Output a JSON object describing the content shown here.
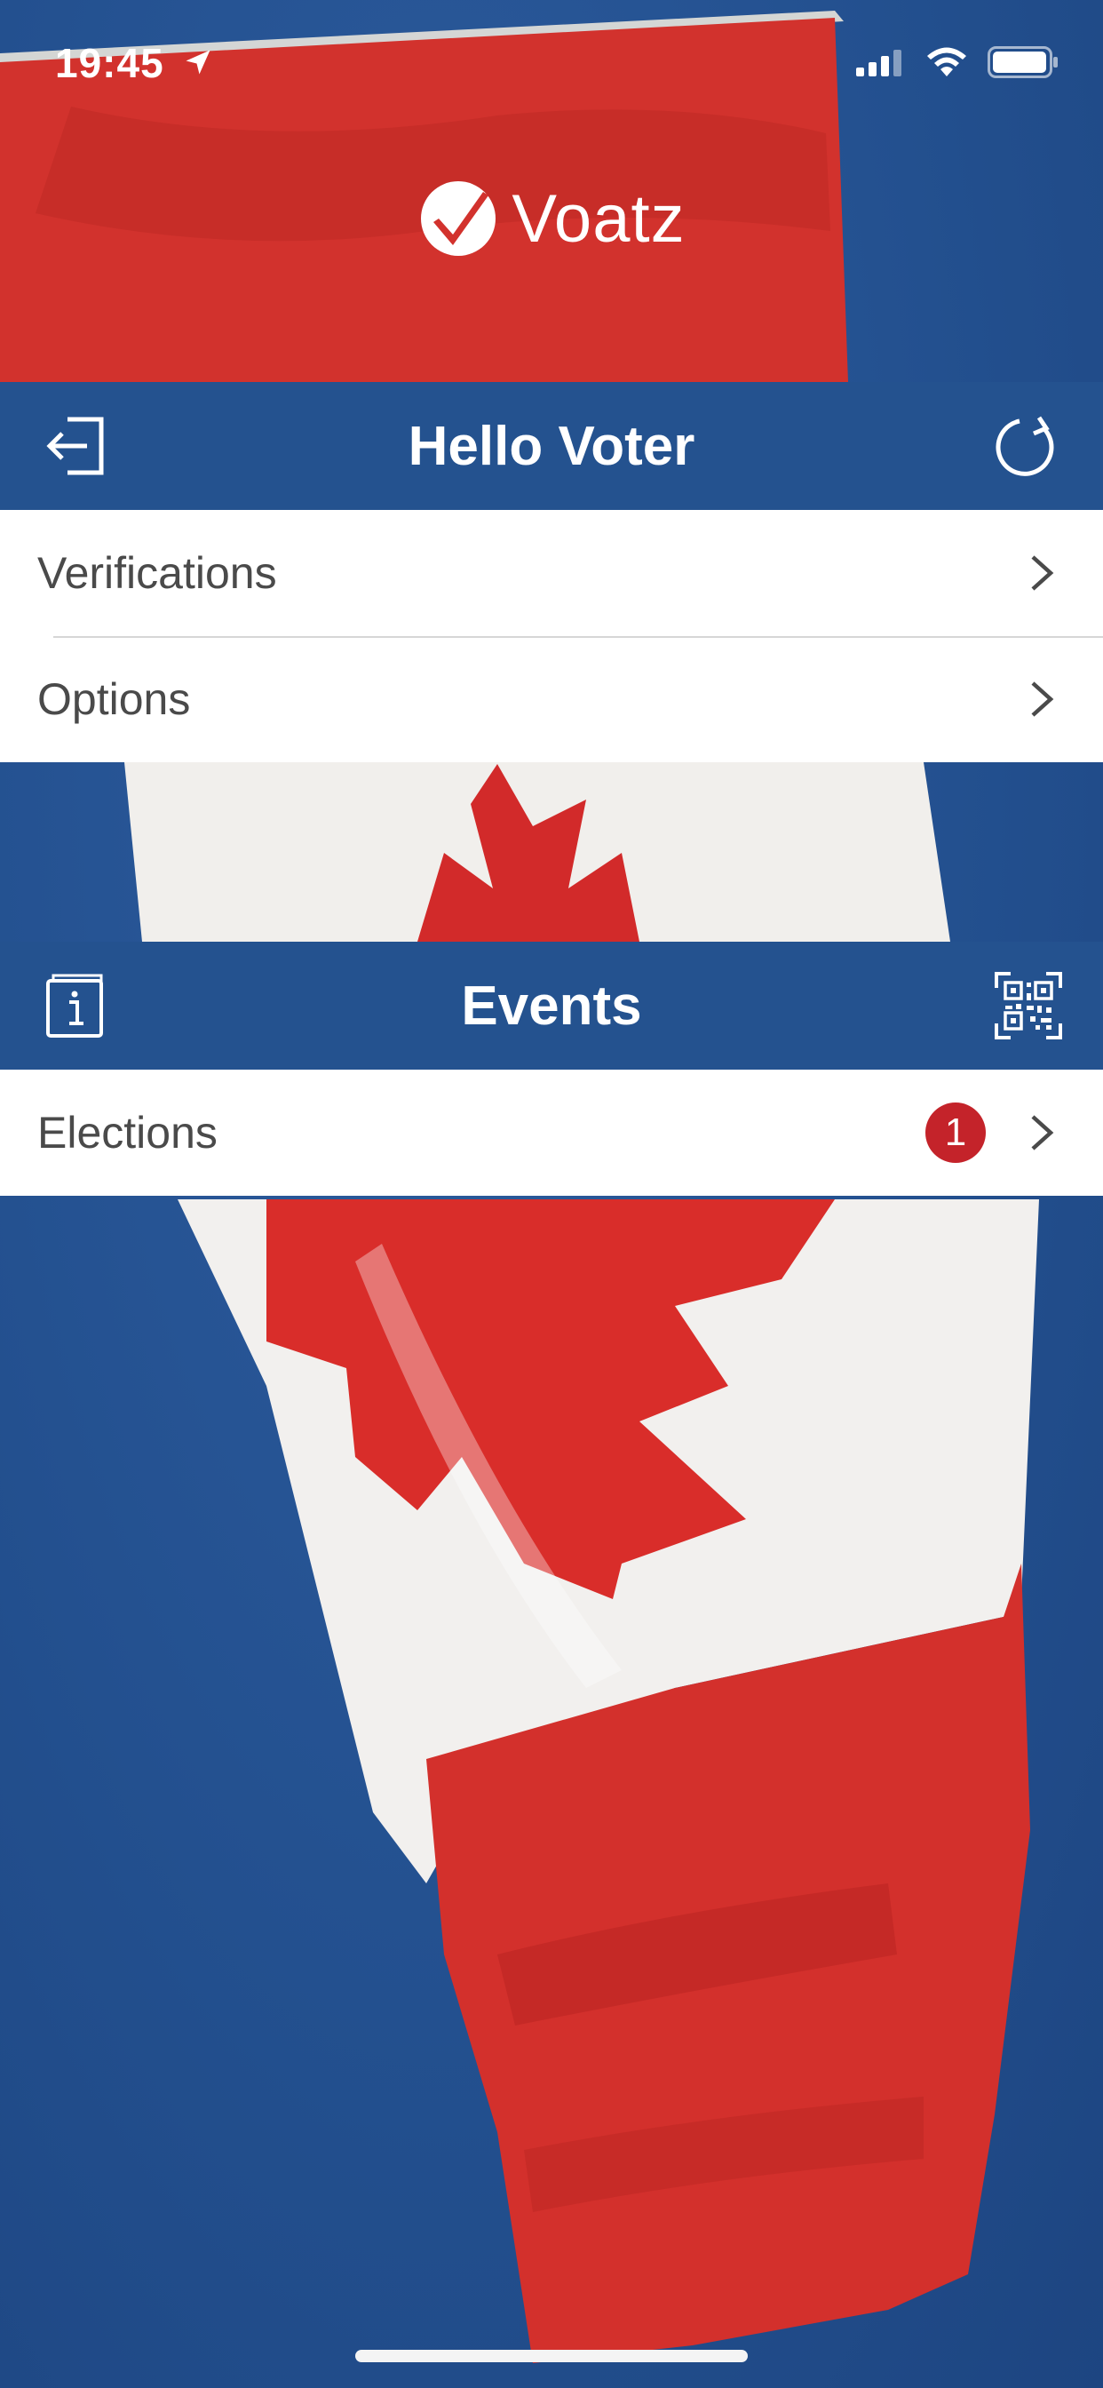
{
  "status_bar": {
    "time": "19:45",
    "icons": [
      "location-arrow-icon",
      "cellular-signal-icon",
      "wifi-icon",
      "battery-icon"
    ]
  },
  "logo": {
    "text": "Voatz",
    "icon": "checkmark-circle-icon"
  },
  "account_section": {
    "title": "Hello Voter",
    "left_icon": "logout-icon",
    "right_icon": "refresh-icon",
    "items": [
      {
        "label": "Verifications"
      },
      {
        "label": "Options"
      }
    ]
  },
  "events_section": {
    "title": "Events",
    "left_icon": "info-book-icon",
    "right_icon": "qr-code-icon",
    "items": [
      {
        "label": "Elections",
        "badge": "1"
      }
    ]
  },
  "colors": {
    "header_blue": "#24528f",
    "badge_red": "#c4232a",
    "row_text": "#4a4a4a",
    "row_background": "#ffffff"
  }
}
